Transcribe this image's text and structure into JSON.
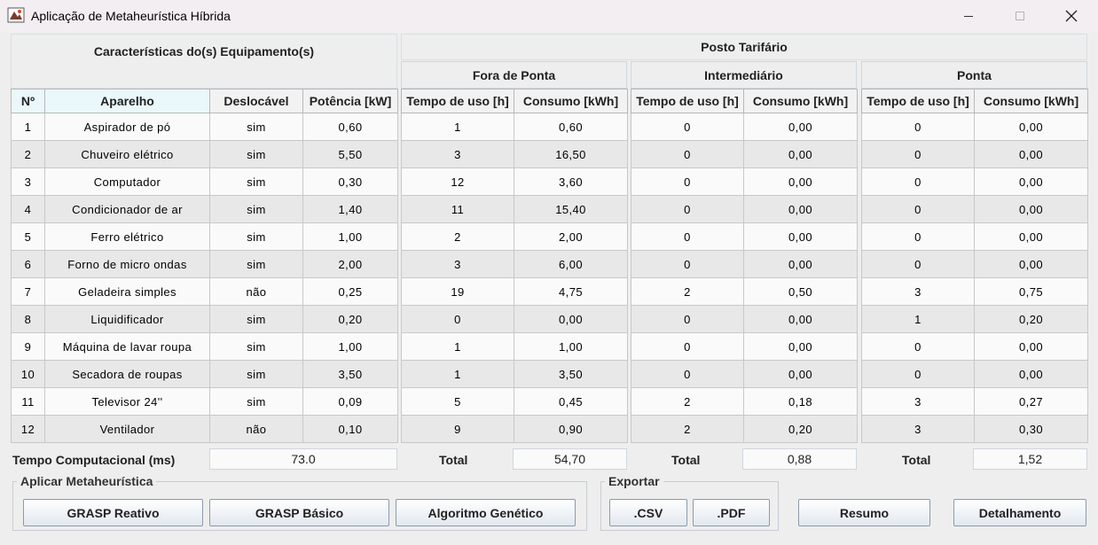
{
  "window": {
    "title": "Aplicação de Metaheurística Híbrida"
  },
  "equipment": {
    "title": "Características do(s) Equipamento(s)",
    "columns": [
      "Nº",
      "Aparelho",
      "Deslocável",
      "Potência [kW]"
    ],
    "rows": [
      [
        "1",
        "Aspirador de pó",
        "sim",
        "0,60"
      ],
      [
        "2",
        "Chuveiro elétrico",
        "sim",
        "5,50"
      ],
      [
        "3",
        "Computador",
        "sim",
        "0,30"
      ],
      [
        "4",
        "Condicionador de ar",
        "sim",
        "1,40"
      ],
      [
        "5",
        "Ferro elétrico",
        "sim",
        "1,00"
      ],
      [
        "6",
        "Forno de micro ondas",
        "sim",
        "2,00"
      ],
      [
        "7",
        "Geladeira simples",
        "não",
        "0,25"
      ],
      [
        "8",
        "Liquidificador",
        "sim",
        "0,20"
      ],
      [
        "9",
        "Máquina de lavar roupa",
        "sim",
        "1,00"
      ],
      [
        "10",
        "Secadora de roupas",
        "sim",
        "3,50"
      ],
      [
        "11",
        "Televisor 24''",
        "sim",
        "0,09"
      ],
      [
        "12",
        "Ventilador",
        "não",
        "0,10"
      ]
    ]
  },
  "tariff": {
    "title": "Posto Tarifário",
    "columns": [
      "Tempo de uso [h]",
      "Consumo [kWh]"
    ],
    "groups": [
      {
        "name": "Fora de Ponta",
        "rows": [
          [
            "1",
            "0,60"
          ],
          [
            "3",
            "16,50"
          ],
          [
            "12",
            "3,60"
          ],
          [
            "11",
            "15,40"
          ],
          [
            "2",
            "2,00"
          ],
          [
            "3",
            "6,00"
          ],
          [
            "19",
            "4,75"
          ],
          [
            "0",
            "0,00"
          ],
          [
            "1",
            "1,00"
          ],
          [
            "1",
            "3,50"
          ],
          [
            "5",
            "0,45"
          ],
          [
            "9",
            "0,90"
          ]
        ],
        "total": "54,70"
      },
      {
        "name": "Intermediário",
        "rows": [
          [
            "0",
            "0,00"
          ],
          [
            "0",
            "0,00"
          ],
          [
            "0",
            "0,00"
          ],
          [
            "0",
            "0,00"
          ],
          [
            "0",
            "0,00"
          ],
          [
            "0",
            "0,00"
          ],
          [
            "2",
            "0,50"
          ],
          [
            "0",
            "0,00"
          ],
          [
            "0",
            "0,00"
          ],
          [
            "0",
            "0,00"
          ],
          [
            "2",
            "0,18"
          ],
          [
            "2",
            "0,20"
          ]
        ],
        "total": "0,88"
      },
      {
        "name": "Ponta",
        "rows": [
          [
            "0",
            "0,00"
          ],
          [
            "0",
            "0,00"
          ],
          [
            "0",
            "0,00"
          ],
          [
            "0",
            "0,00"
          ],
          [
            "0",
            "0,00"
          ],
          [
            "0",
            "0,00"
          ],
          [
            "3",
            "0,75"
          ],
          [
            "1",
            "0,20"
          ],
          [
            "0",
            "0,00"
          ],
          [
            "0",
            "0,00"
          ],
          [
            "3",
            "0,27"
          ],
          [
            "3",
            "0,30"
          ]
        ],
        "total": "1,52"
      }
    ],
    "total_label": "Total"
  },
  "computation": {
    "label": "Tempo Computacional (ms)",
    "value": "73.0"
  },
  "metaheuristic": {
    "legend": "Aplicar Metaheurística",
    "buttons": [
      "GRASP Reativo",
      "GRASP Básico",
      "Algoritmo Genético"
    ]
  },
  "export": {
    "legend": "Exportar",
    "buttons": [
      ".CSV",
      ".PDF"
    ]
  },
  "actions": {
    "summary": "Resumo",
    "detail": "Detalhamento"
  }
}
